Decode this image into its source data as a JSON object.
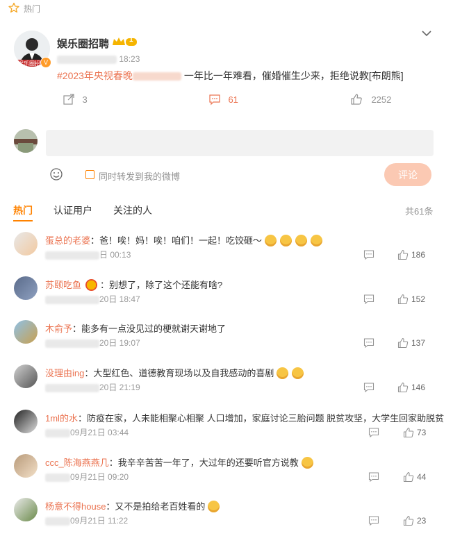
{
  "section_label": "热门",
  "post": {
    "author": "娱乐圈招聘",
    "member_level": "1",
    "avatar_caption": "娱乐圈招",
    "time": "18:23",
    "hashtag": "#2023年央视春晚",
    "text": "一年比一年难看，催婚催生少来，拒绝说教[布朗熊]",
    "reposts": "3",
    "comments": "61",
    "likes": "2252"
  },
  "compose": {
    "input_placeholder": "",
    "repost_label": "同时转发到我的微博",
    "submit_label": "评论"
  },
  "tabs": [
    "热门",
    "认证用户",
    "关注的人"
  ],
  "total_count": "共61条",
  "comments": [
    {
      "user": "蛋总的老婆",
      "text": "：爸！唉！妈！唉！咱们！一起！吃饺砸～",
      "emoji_count": 4,
      "time": "日 00:13",
      "likes": "186"
    },
    {
      "user": "苏颐吃鱼",
      "text": "：别想了，除了这个还能有啥?",
      "emoji_count": 0,
      "time": "20日 18:47",
      "likes": "152"
    },
    {
      "user": "木俞予",
      "text": "：能多有一点没见过的梗就谢天谢地了",
      "emoji_count": 0,
      "time": "20日 19:07",
      "likes": "137"
    },
    {
      "user": "没理由ing",
      "text": "：大型红色、道德教育现场以及自我感动的喜剧",
      "emoji_count": 2,
      "time": "20日 21:19",
      "likes": "146"
    },
    {
      "user": "1ml的水",
      "text": "：防疫在家，人未能相聚心相聚 人口增加，家庭讨论三胎问题 脱贫攻坚，大学生回家助脱贫",
      "emoji_count": 0,
      "time": "09月21日 03:44",
      "likes": "73"
    },
    {
      "user": "ccc_陈海燕燕几",
      "text": "：我辛辛苦苦一年了，大过年的还要听官方说教",
      "emoji_count": 1,
      "time": "09月21日 09:20",
      "likes": "44"
    },
    {
      "user": "杨意不得house",
      "text": "：又不是拍给老百姓看的",
      "emoji_count": 1,
      "time": "09月21日 11:22",
      "likes": "23"
    }
  ],
  "colors": {
    "accent": "#ff8200",
    "username": "#eb7350",
    "muted": "#939393"
  }
}
